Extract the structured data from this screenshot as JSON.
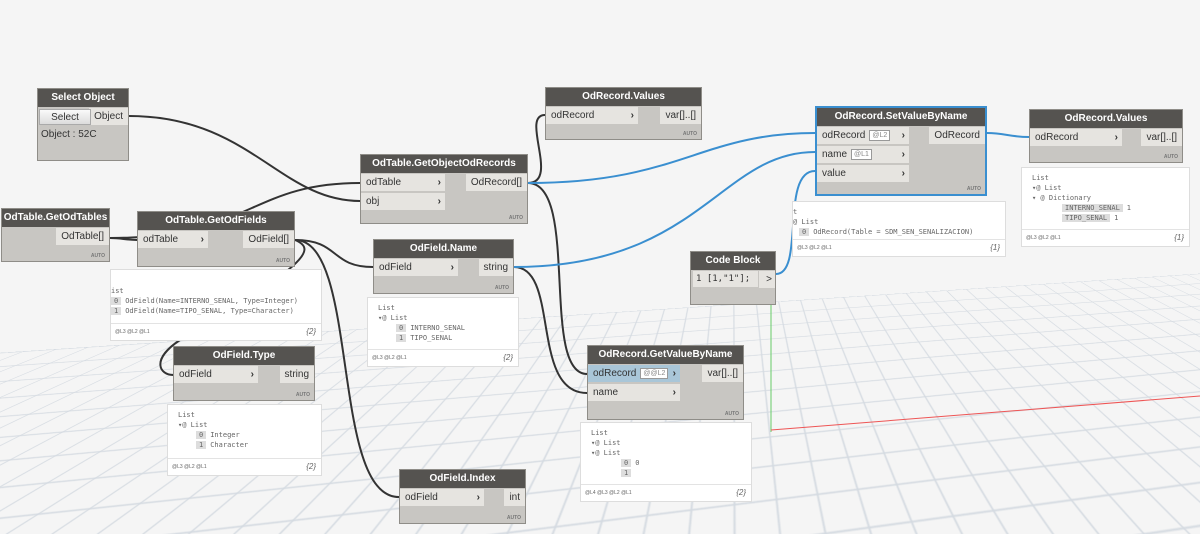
{
  "nodes": {
    "select_object": {
      "title": "Select Object",
      "button": "Select",
      "outputs": [
        "Object"
      ],
      "value": "Object : 52C"
    },
    "get_od_tables": {
      "title": "OdTable.GetOdTables",
      "outputs": [
        "OdTable[]"
      ],
      "footer": "AUTO"
    },
    "get_od_fields": {
      "title": "OdTable.GetOdFields",
      "inputs": [
        {
          "label": "odTable"
        }
      ],
      "outputs": [
        "OdField[]"
      ],
      "footer": "AUTO"
    },
    "get_object_od_records": {
      "title": "OdTable.GetObjectOdRecords",
      "inputs": [
        {
          "label": "odTable"
        },
        {
          "label": "obj"
        }
      ],
      "outputs": [
        "OdRecord[]"
      ],
      "footer": "AUTO"
    },
    "od_record_values_1": {
      "title": "OdRecord.Values",
      "inputs": [
        {
          "label": "odRecord"
        }
      ],
      "outputs": [
        "var[]..[]"
      ],
      "footer": "AUTO"
    },
    "od_field_name": {
      "title": "OdField.Name",
      "inputs": [
        {
          "label": "odField"
        }
      ],
      "outputs": [
        "string"
      ],
      "footer": "AUTO"
    },
    "set_value_by_name": {
      "title": "OdRecord.SetValueByName",
      "inputs": [
        {
          "label": "odRecord",
          "lacing": "@L2"
        },
        {
          "label": "name",
          "lacing": "@L1"
        },
        {
          "label": "value"
        }
      ],
      "outputs": [
        "OdRecord"
      ],
      "footer": "AUTO"
    },
    "od_record_values_2": {
      "title": "OdRecord.Values",
      "inputs": [
        {
          "label": "odRecord"
        }
      ],
      "outputs": [
        "var[]..[]"
      ],
      "footer": "AUTO"
    },
    "code_block": {
      "title": "Code Block",
      "code": "1 [1,\"1\"];",
      "outputs": [
        ">"
      ]
    },
    "od_field_type": {
      "title": "OdField.Type",
      "inputs": [
        {
          "label": "odField"
        }
      ],
      "outputs": [
        "string"
      ],
      "footer": "AUTO"
    },
    "get_value_by_name": {
      "title": "OdRecord.GetValueByName",
      "inputs": [
        {
          "label": "odRecord",
          "lacing": "@@L2"
        },
        {
          "label": "name"
        }
      ],
      "outputs": [
        "var[]..[]"
      ],
      "footer": "AUTO"
    },
    "od_field_index": {
      "title": "OdField.Index",
      "inputs": [
        {
          "label": "odField"
        }
      ],
      "outputs": [
        "int"
      ],
      "footer": "AUTO"
    }
  },
  "previews": {
    "get_od_fields": {
      "lines": [
        {
          "text": "ist"
        },
        {
          "idx": "0",
          "text": "OdField(Name=INTERNO_SENAL, Type=Integer)"
        },
        {
          "idx": "1",
          "text": "OdField(Name=TIPO_SENAL, Type=Character)"
        }
      ],
      "levels": "@L3 @L2 @L1",
      "count": "{2}"
    },
    "od_field_name": {
      "lines": [
        {
          "text": "List"
        },
        {
          "text": "  ▾@ List"
        },
        {
          "idx": "0",
          "text": "INTERNO_SENAL",
          "indent": 3
        },
        {
          "idx": "1",
          "text": "TIPO_SENAL",
          "indent": 3
        }
      ],
      "levels": "@L3 @L2 @L1",
      "count": "{2}"
    },
    "set_value_by_name": {
      "lines": [
        {
          "text": "t"
        },
        {
          "text": "@ List"
        },
        {
          "idx": "0",
          "text": "OdRecord(Table = SDM_SEN_SENALIZACION)",
          "indent": 1
        }
      ],
      "levels": "@L3 @L2 @L1",
      "count": "{1}"
    },
    "od_record_values_2": {
      "lines": [
        {
          "text": "List"
        },
        {
          "text": "  ▾@ List"
        },
        {
          "text": "    ▾ @  Dictionary"
        },
        {
          "idx": "INTERNO_SENAL",
          "text": "1",
          "indent": 5
        },
        {
          "idx": "TIPO_SENAL",
          "text": "1",
          "indent": 5
        }
      ],
      "levels": "@L3 @L2 @L1",
      "count": "{1}"
    },
    "od_field_type": {
      "lines": [
        {
          "text": "List"
        },
        {
          "text": "  ▾@ List"
        },
        {
          "idx": "0",
          "text": "Integer",
          "indent": 3
        },
        {
          "idx": "1",
          "text": "Character",
          "indent": 3
        }
      ],
      "levels": "@L3 @L2 @L1",
      "count": "{2}"
    },
    "get_value_by_name": {
      "lines": [
        {
          "text": "List"
        },
        {
          "text": "  ▾@ List"
        },
        {
          "text": "    ▾@ List"
        },
        {
          "idx": "0",
          "text": "0",
          "indent": 5
        },
        {
          "idx": "1",
          "text": "",
          "indent": 5
        }
      ],
      "levels": "@L4 @L3 @L2 @L1",
      "count": "{2}"
    }
  },
  "colors": {
    "wire": "#333333",
    "wire_selected": "#3a8fd0",
    "node_header": "#555350",
    "node_body": "#c8c6c2"
  }
}
